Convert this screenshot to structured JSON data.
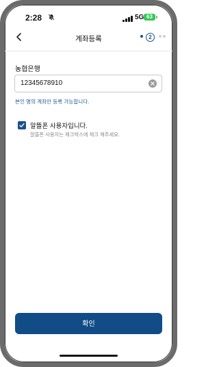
{
  "status_bar": {
    "time": "2:28",
    "network": "5G",
    "battery": "63"
  },
  "nav": {
    "title": "계좌등록",
    "step": "2"
  },
  "form": {
    "bank_name": "농협은행",
    "account_number": "12345678910",
    "hint": "본인 명의 계좌만 등록 가능합니다.",
    "checkbox_label": "알뜰폰 사용자입니다.",
    "checkbox_sub": "알뜰폰 사용자는 체크박스에 체크 해주세요.",
    "checkbox_checked": true
  },
  "actions": {
    "confirm_label": "확인"
  },
  "colors": {
    "primary": "#114c87",
    "hint": "#1f5a9a",
    "battery": "#34c759"
  }
}
